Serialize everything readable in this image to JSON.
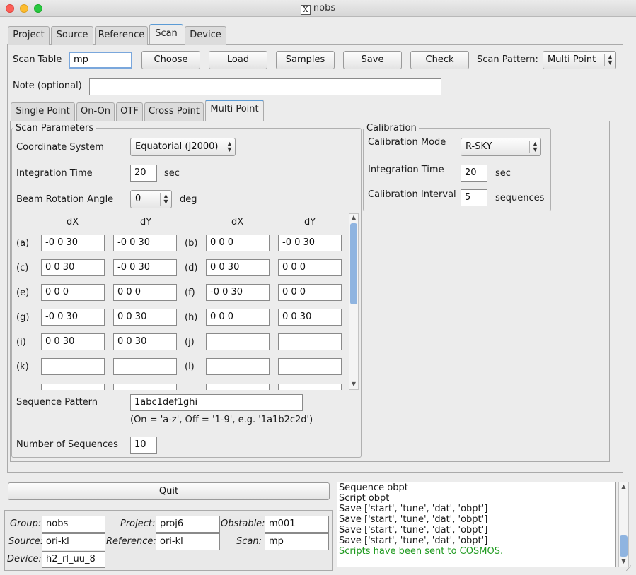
{
  "window": {
    "title": "nobs",
    "x_logo": "X"
  },
  "main_tabs": [
    "Project",
    "Source",
    "Reference",
    "Scan",
    "Device"
  ],
  "scan_row": {
    "scan_table_label": "Scan Table",
    "scan_table_value": "mp",
    "buttons": [
      "Choose",
      "Load",
      "Samples",
      "Save",
      "Check"
    ],
    "scan_pattern_label": "Scan Pattern:",
    "scan_pattern_value": "Multi Point"
  },
  "note": {
    "label": "Note (optional)",
    "value": ""
  },
  "sub_tabs": [
    "Single Point",
    "On-On",
    "OTF",
    "Cross Point",
    "Multi Point"
  ],
  "scan_params": {
    "title": "Scan Parameters",
    "coord_label": "Coordinate System",
    "coord_value": "Equatorial (J2000)",
    "int_time_label": "Integration Time",
    "int_time_value": "20",
    "int_time_unit": "sec",
    "beam_label": "Beam Rotation Angle",
    "beam_value": "0",
    "beam_unit": "deg",
    "headers": [
      "dX",
      "dY",
      "dX",
      "dY"
    ],
    "points": [
      {
        "l1": "(a)",
        "x1": "-0 0 30",
        "y1": "-0 0 30",
        "l2": "(b)",
        "x2": "0 0 0",
        "y2": "-0 0 30"
      },
      {
        "l1": "(c)",
        "x1": "0 0 30",
        "y1": "-0 0 30",
        "l2": "(d)",
        "x2": "0 0 30",
        "y2": "0 0 0"
      },
      {
        "l1": "(e)",
        "x1": "0 0 0",
        "y1": "0 0 0",
        "l2": "(f)",
        "x2": "-0 0 30",
        "y2": "0 0 0"
      },
      {
        "l1": "(g)",
        "x1": "-0 0 30",
        "y1": "0 0 30",
        "l2": "(h)",
        "x2": "0 0 0",
        "y2": "0 0 30"
      },
      {
        "l1": "(i)",
        "x1": "0 0 30",
        "y1": "0 0 30",
        "l2": "(j)",
        "x2": "",
        "y2": ""
      },
      {
        "l1": "(k)",
        "x1": "",
        "y1": "",
        "l2": "(l)",
        "x2": "",
        "y2": ""
      }
    ],
    "seq_label": "Sequence Pattern",
    "seq_value": "1abc1def1ghi",
    "seq_hint": "(On = 'a-z', Off = '1-9', e.g. '1a1b2c2d')",
    "num_seq_label": "Number of Sequences",
    "num_seq_value": "10"
  },
  "calibration": {
    "title": "Calibration",
    "mode_label": "Calibration Mode",
    "mode_value": "R-SKY",
    "int_time_label": "Integration Time",
    "int_time_value": "20",
    "int_time_unit": "sec",
    "interval_label": "Calibration Interval",
    "interval_value": "5",
    "interval_unit": "sequences"
  },
  "quit_label": "Quit",
  "info": {
    "group_label": "Group:",
    "group_value": "nobs",
    "project_label": "Project:",
    "project_value": "proj6",
    "obstable_label": "Obstable:",
    "obstable_value": "m001",
    "source_label": "Source:",
    "source_value": "ori-kl",
    "reference_label": "Reference:",
    "reference_value": "ori-kl",
    "scan_label": "Scan:",
    "scan_value": "mp",
    "device_label": "Device:",
    "device_value": "h2_rl_uu_8"
  },
  "log": {
    "lines": [
      "Sequence obpt",
      "Script obpt",
      "Save ['start', 'tune', 'dat', 'obpt']",
      "Save ['start', 'tune', 'dat', 'obpt']",
      "Save ['start', 'tune', 'dat', 'obpt']",
      "Save ['start', 'tune', 'dat', 'obpt']"
    ],
    "success_line": "Scripts have been sent to COSMOS.",
    "success_color": "#1f9a1f"
  },
  "colors": {
    "accent": "#5b9bd5",
    "scroll_thumb": "#8fb4e0"
  }
}
